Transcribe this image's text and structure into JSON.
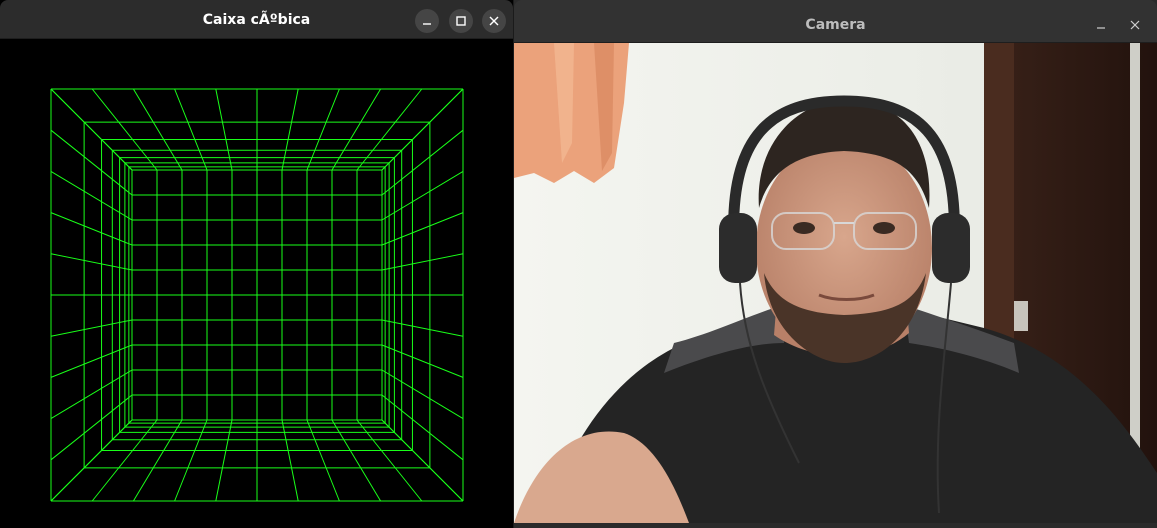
{
  "left_window": {
    "title": "Caixa cÃºbica",
    "buttons": [
      "minimize",
      "maximize",
      "close"
    ],
    "line_color": "#19ff19",
    "background": "#000000",
    "grid_divisions": 10,
    "depth_rings": 7
  },
  "right_window": {
    "title": "Camera",
    "buttons": [
      "minimize",
      "close"
    ],
    "content": "webcam feed: man wearing headphones and glasses, black t-shirt"
  },
  "icons": {
    "minimize": "minimize-icon",
    "maximize": "maximize-icon",
    "close": "close-icon"
  }
}
